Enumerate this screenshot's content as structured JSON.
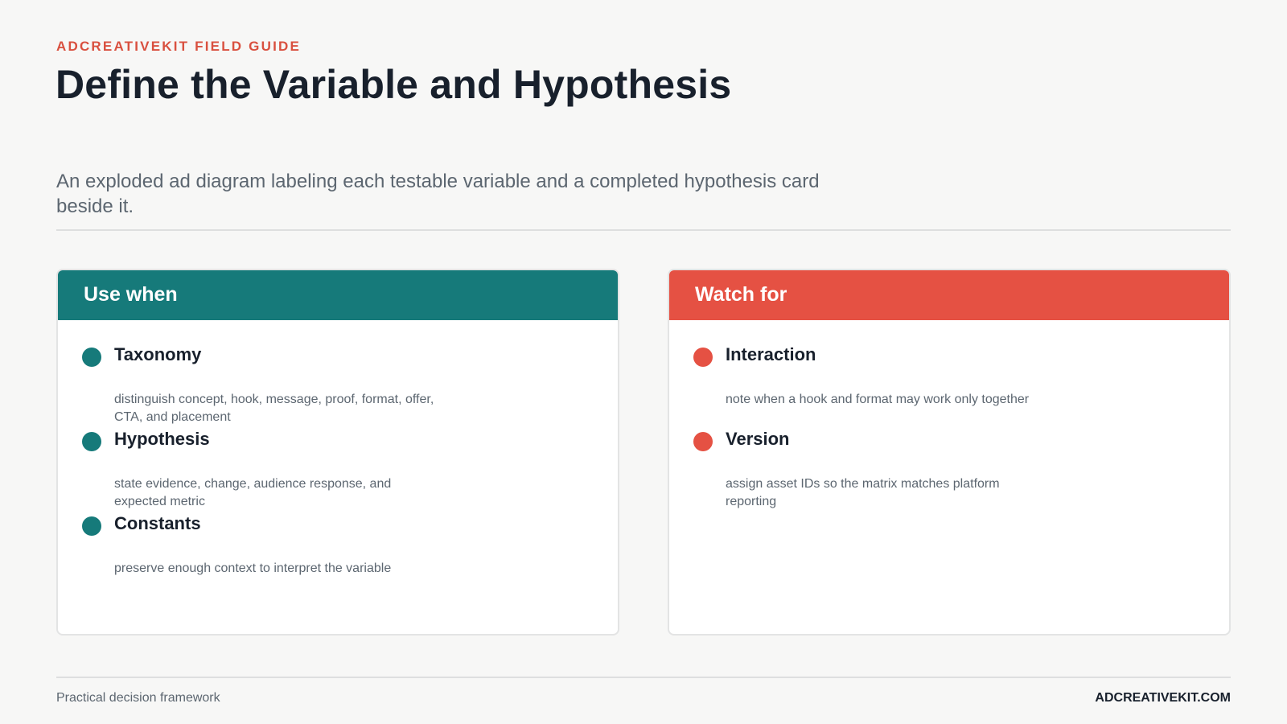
{
  "header": {
    "eyebrow": "ADCREATIVEKIT FIELD GUIDE",
    "title": "Define the Variable and Hypothesis",
    "subtitle": "An exploded ad diagram labeling each testable variable and a completed hypothesis card beside it."
  },
  "cards": [
    {
      "heading": "Use when",
      "accent_color": "#167a7a",
      "items": [
        {
          "title": "Taxonomy",
          "text": "distinguish concept, hook, message, proof, format, offer, CTA, and placement"
        },
        {
          "title": "Hypothesis",
          "text": "state evidence, change, audience response, and expected metric"
        },
        {
          "title": "Constants",
          "text": "preserve enough context to interpret the variable"
        }
      ]
    },
    {
      "heading": "Watch for",
      "accent_color": "#e55143",
      "items": [
        {
          "title": "Interaction",
          "text": "note when a hook and format may work only together"
        },
        {
          "title": "Version",
          "text": "assign asset IDs so the matrix matches platform reporting"
        }
      ]
    }
  ],
  "footer": {
    "left": "Practical decision framework",
    "right": "ADCREATIVEKIT.COM"
  },
  "colors": {
    "brand_red": "#d9503f",
    "teal": "#167a7a",
    "background": "#f7f7f6"
  }
}
